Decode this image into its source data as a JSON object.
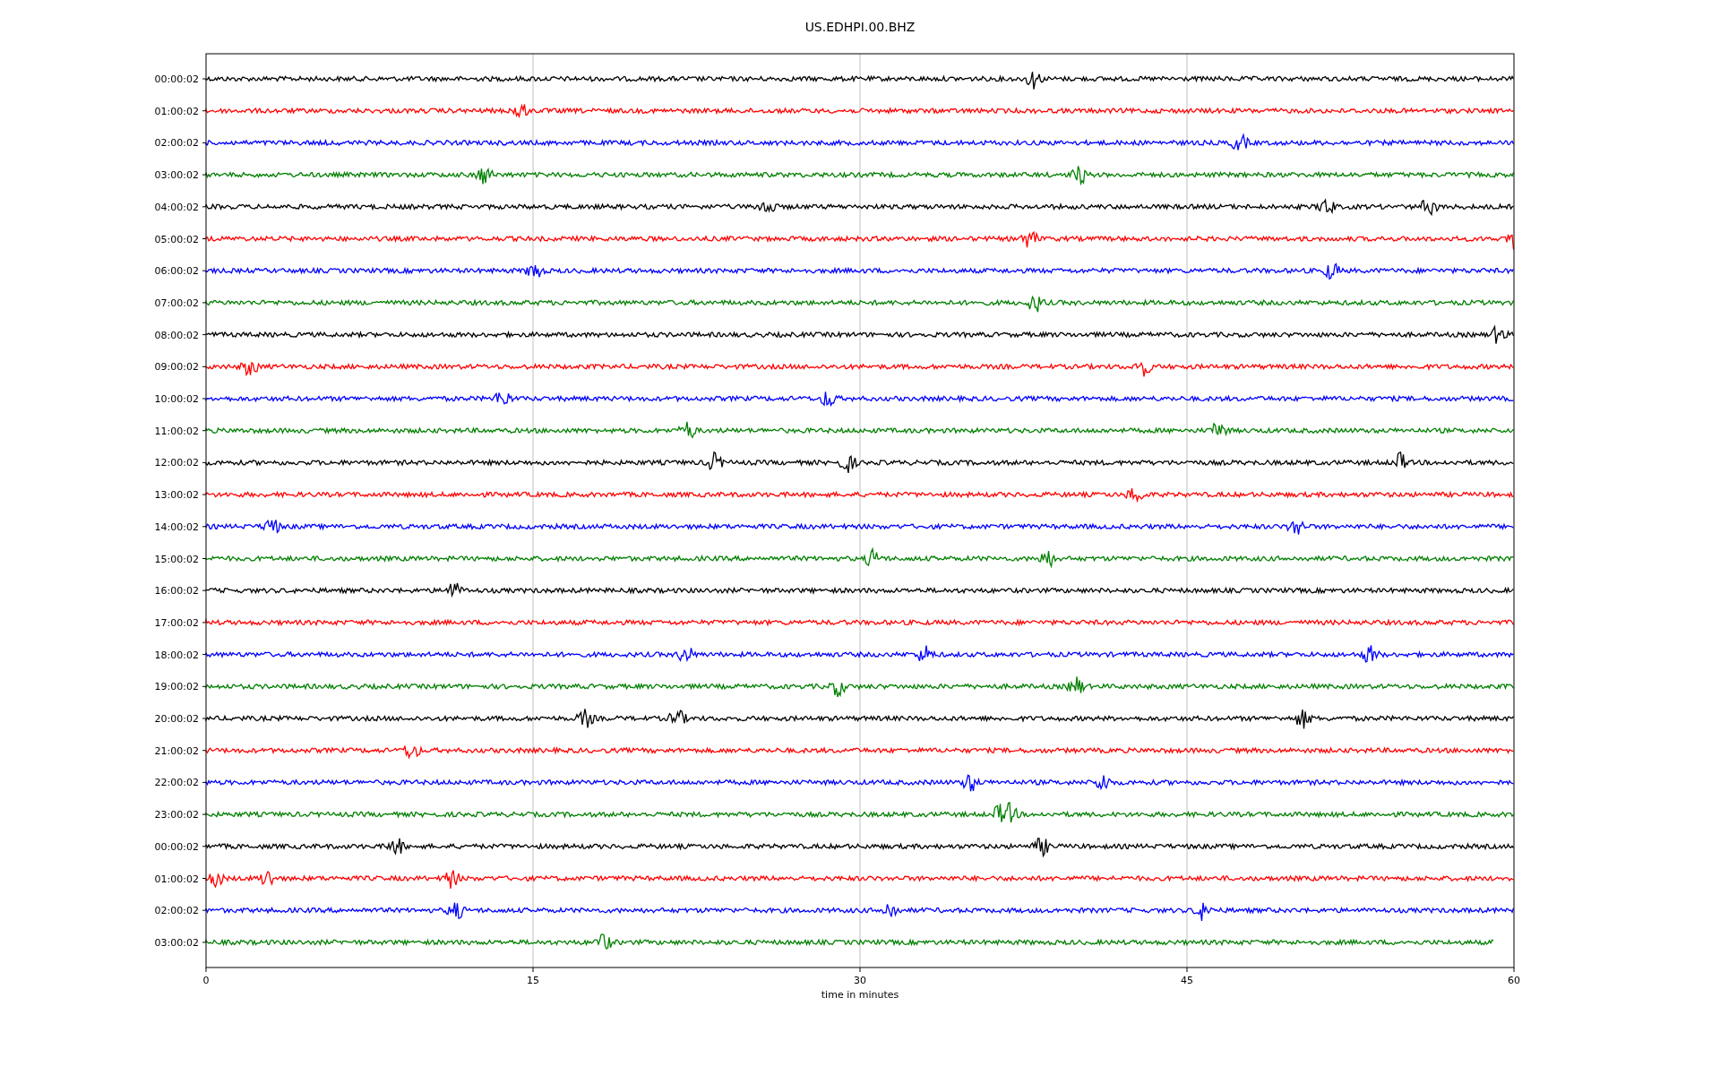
{
  "title": "US.EDHPI.00.BHZ",
  "rows": [
    {
      "label": "00:00:02",
      "color": "#000000"
    },
    {
      "label": "01:00:02",
      "color": "#ff0000"
    },
    {
      "label": "02:00:02",
      "color": "#0000ff"
    },
    {
      "label": "03:00:02",
      "color": "#008000"
    },
    {
      "label": "04:00:02",
      "color": "#000000"
    },
    {
      "label": "05:00:02",
      "color": "#ff0000"
    },
    {
      "label": "06:00:02",
      "color": "#0000ff"
    },
    {
      "label": "07:00:02",
      "color": "#008000"
    },
    {
      "label": "08:00:02",
      "color": "#000000"
    },
    {
      "label": "09:00:02",
      "color": "#ff0000"
    },
    {
      "label": "10:00:02",
      "color": "#0000ff"
    },
    {
      "label": "11:00:02",
      "color": "#008000"
    },
    {
      "label": "12:00:02",
      "color": "#000000"
    },
    {
      "label": "13:00:02",
      "color": "#ff0000"
    },
    {
      "label": "14:00:02",
      "color": "#0000ff"
    },
    {
      "label": "15:00:02",
      "color": "#008000"
    },
    {
      "label": "16:00:02",
      "color": "#000000"
    },
    {
      "label": "17:00:02",
      "color": "#ff0000"
    },
    {
      "label": "18:00:02",
      "color": "#0000ff"
    },
    {
      "label": "19:00:02",
      "color": "#008000"
    },
    {
      "label": "20:00:02",
      "color": "#000000"
    },
    {
      "label": "21:00:02",
      "color": "#ff0000"
    },
    {
      "label": "22:00:02",
      "color": "#0000ff"
    },
    {
      "label": "23:00:02",
      "color": "#008000"
    },
    {
      "label": "00:00:02",
      "color": "#000000"
    },
    {
      "label": "01:00:02",
      "color": "#ff0000"
    },
    {
      "label": "02:00:02",
      "color": "#0000ff"
    },
    {
      "label": "03:00:02",
      "color": "#008000"
    }
  ],
  "x_axis": {
    "ticks": [
      "0",
      "15",
      "30",
      "45",
      "60"
    ],
    "label": "time in minutes"
  }
}
